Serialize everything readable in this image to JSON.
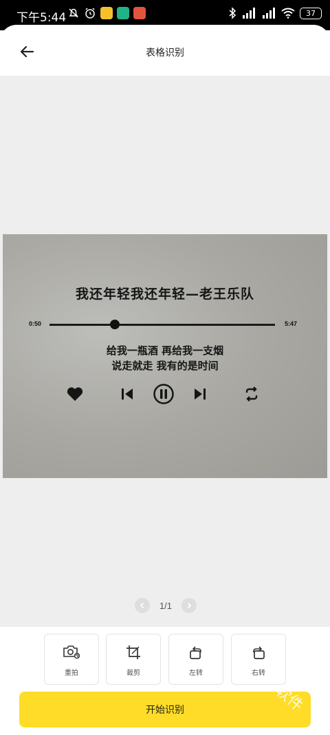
{
  "status_bar": {
    "time": "下午5:44",
    "battery": "37"
  },
  "header": {
    "title": "表格识别"
  },
  "photo": {
    "headline": "我还年轻我还年轻—老王乐队",
    "time_elapsed": "0:50",
    "time_total": "5:47",
    "progress": 0.29,
    "lyric_line_1": "给我一瓶酒 再给我一支烟",
    "lyric_line_2": "说走就走 我有的是时间"
  },
  "pager": {
    "text": "1/1"
  },
  "tools": [
    {
      "label": "重拍",
      "icon": "camera-retake-icon"
    },
    {
      "label": "裁剪",
      "icon": "crop-icon"
    },
    {
      "label": "左转",
      "icon": "rotate-left-icon"
    },
    {
      "label": "右转",
      "icon": "rotate-right-icon"
    }
  ],
  "actions": {
    "start_label": "开始识别"
  },
  "watermark": "软件"
}
